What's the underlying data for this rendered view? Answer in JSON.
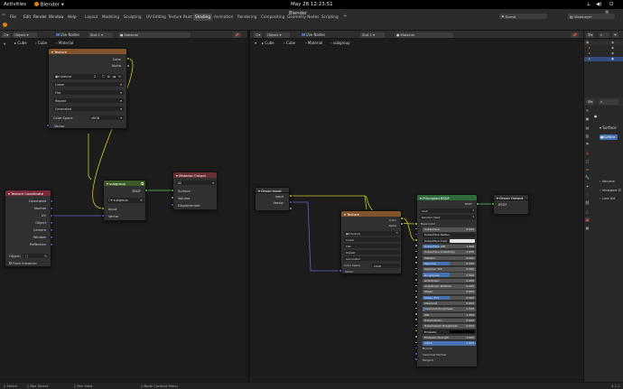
{
  "system_bar": {
    "activities": "Activities",
    "app_name": "Blender",
    "clock": "May 28  12:23:51"
  },
  "window": {
    "title": "Blender"
  },
  "menu": [
    "File",
    "Edit",
    "Render",
    "Window",
    "Help"
  ],
  "workspaces": [
    "Layout",
    "Modeling",
    "Sculpting",
    "UV Editing",
    "Texture Paint",
    "Shading",
    "Animation",
    "Rendering",
    "Compositing",
    "Geometry Nodes",
    "Scripting"
  ],
  "active_workspace": "Shading",
  "scene": {
    "scene_label": "Scene",
    "view_layer_label": "ViewLayer"
  },
  "left_editor": {
    "header": {
      "mode": "Object",
      "use_nodes": "Use Nodes",
      "slot": "Slot 1",
      "material": "Material"
    },
    "breadcrumb": [
      "Cube",
      "Cube",
      "Material"
    ],
    "texture_node": {
      "title": "Texture",
      "out_color": "Color",
      "out_alpha": "Alpha",
      "image": "texture",
      "users": "2",
      "interpolation": "Linear",
      "projection": "Flat",
      "extension": "Repeat",
      "source": "Generated",
      "color_space_label": "Color Space",
      "color_space": "sRGB",
      "in_vector": "Vector"
    },
    "subgroup_node": {
      "title": "subgroup",
      "out_bsdf": "BSDF",
      "group": "subgroup",
      "in_input": "Input",
      "in_vector": "Vector"
    },
    "material_output_node": {
      "title": "Material Output",
      "target": "All",
      "surface": "Surface",
      "volume": "Volume",
      "displacement": "Displacement"
    },
    "texcoord_node": {
      "title": "Texture Coordinate",
      "outputs": [
        "Generated",
        "Normal",
        "UV",
        "Object",
        "Camera",
        "Window",
        "Reflection"
      ],
      "object_label": "Object:",
      "from_instancer": "From Instancer"
    }
  },
  "right_editor": {
    "header": {
      "mode": "Object",
      "use_nodes": "Use Nodes",
      "slot": "Slot 1",
      "material": "Material"
    },
    "breadcrumb": [
      "Cube",
      "Cube",
      "Material",
      "subgroup"
    ],
    "group_input_node": {
      "title": "Group Input",
      "out_input": "Input",
      "out_vector": "Vector"
    },
    "group_output_node": {
      "title": "Group Output",
      "in_bsdf": "BSDF"
    },
    "texture_node": {
      "title": "Texture",
      "out_color": "Color",
      "out_alpha": "Alpha",
      "image": "texture",
      "interpolation": "Linear",
      "projection": "Flat",
      "extension": "Repeat",
      "source": "Generated",
      "color_space_label": "Color Space",
      "color_space": "sRGB",
      "in_vector": "Vector"
    },
    "principled_node": {
      "title": "Principled BSDF",
      "out_bsdf": "BSDF",
      "distribution": "GGX",
      "sss_method": "Random Walk",
      "base_color": "Base Color",
      "rows": [
        {
          "label": "Subsurface",
          "value": "0.000",
          "fill": 0
        },
        {
          "label": "Subsurface Radius",
          "value": "",
          "fill": 0
        },
        {
          "label": "Subsurface Color",
          "value": "",
          "fill": 0
        },
        {
          "label": "Subsurface IOR",
          "value": "1.400",
          "fill": 0.3
        },
        {
          "label": "Subsurface Anisotropy",
          "value": "0.000",
          "fill": 0
        },
        {
          "label": "Metallic",
          "value": "0.000",
          "fill": 0
        },
        {
          "label": "Specular",
          "value": "0.500",
          "fill": 0.5
        },
        {
          "label": "Specular Tint",
          "value": "0.000",
          "fill": 0
        },
        {
          "label": "Roughness",
          "value": "0.500",
          "fill": 0.5
        },
        {
          "label": "Anisotropic",
          "value": "0.000",
          "fill": 0
        },
        {
          "label": "Anisotropic Rotation",
          "value": "0.000",
          "fill": 0
        },
        {
          "label": "Sheen",
          "value": "0.000",
          "fill": 0
        },
        {
          "label": "Sheen Tint",
          "value": "0.500",
          "fill": 0.5
        },
        {
          "label": "Clearcoat",
          "value": "0.000",
          "fill": 0
        },
        {
          "label": "Clearcoat Roughness",
          "value": "0.030",
          "fill": 0.03
        },
        {
          "label": "IOR",
          "value": "1.450",
          "fill": 0
        },
        {
          "label": "Transmission",
          "value": "0.000",
          "fill": 0
        },
        {
          "label": "Transmission Roughness",
          "value": "0.000",
          "fill": 0
        },
        {
          "label": "Emission",
          "value": "",
          "fill": 0
        },
        {
          "label": "Emission Strength",
          "value": "1.000",
          "fill": 0
        },
        {
          "label": "Alpha",
          "value": "1.000",
          "fill": 1
        }
      ],
      "tail": [
        "Normal",
        "Clearcoat Normal",
        "Tangent"
      ]
    }
  },
  "properties": {
    "surface_tab": "Surface",
    "surface_btn": "Surface",
    "items": [
      "Volume",
      "Viewport D",
      "Line Art"
    ]
  },
  "status_bar": {
    "select": "Select",
    "box_select": "Box Select",
    "pan_view": "Pan View",
    "context_menu": "Node Context Menu",
    "version": "3.1.2"
  },
  "colors": {
    "texture_hdr": "#83542c",
    "group_hdr": "#3b5a26",
    "output_hdr": "#6b2d34",
    "input_hdr": "#7b2a3d",
    "vector_hdr": "#3b3b80",
    "bsdf_hdr": "#2f6b3a",
    "wire_color": "#c7c729",
    "wire_vector": "#6363c7",
    "wire_shader": "#63c763"
  }
}
